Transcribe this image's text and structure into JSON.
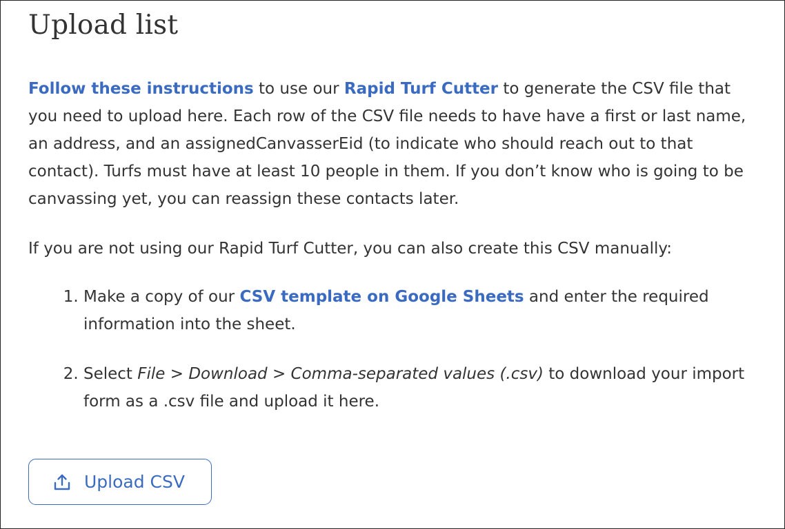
{
  "page": {
    "title": "Upload list"
  },
  "intro": {
    "link_instructions": "Follow these instructions",
    "text_a": " to use our ",
    "link_cutter": "Rapid Turf Cutter",
    "text_b": " to generate the CSV file that you need to upload here. Each row of the CSV file needs to have have a first or last name, an address, and an assignedCanvasserEid (to indicate who should reach out to that contact). Turfs must have at least 10 people in them. If you don’t know who is going to be canvassing yet, you can reassign these contacts later."
  },
  "manual": {
    "text": "If you are not using our Rapid Turf Cutter, you can also create this CSV manually:"
  },
  "steps": [
    {
      "text_a": "Make a copy of our ",
      "link": "CSV template on Google Sheets",
      "text_b": " and enter the required information into the sheet."
    },
    {
      "text_a": "Select ",
      "emphasis": "File > Download > Comma-separated values (.csv)",
      "text_b": " to download your import form as a .csv file and upload it here."
    }
  ],
  "upload_button": {
    "icon": "upload-icon",
    "label": "Upload CSV"
  },
  "colors": {
    "link": "#3a6bc0",
    "text": "#333333",
    "border": "#222222"
  }
}
